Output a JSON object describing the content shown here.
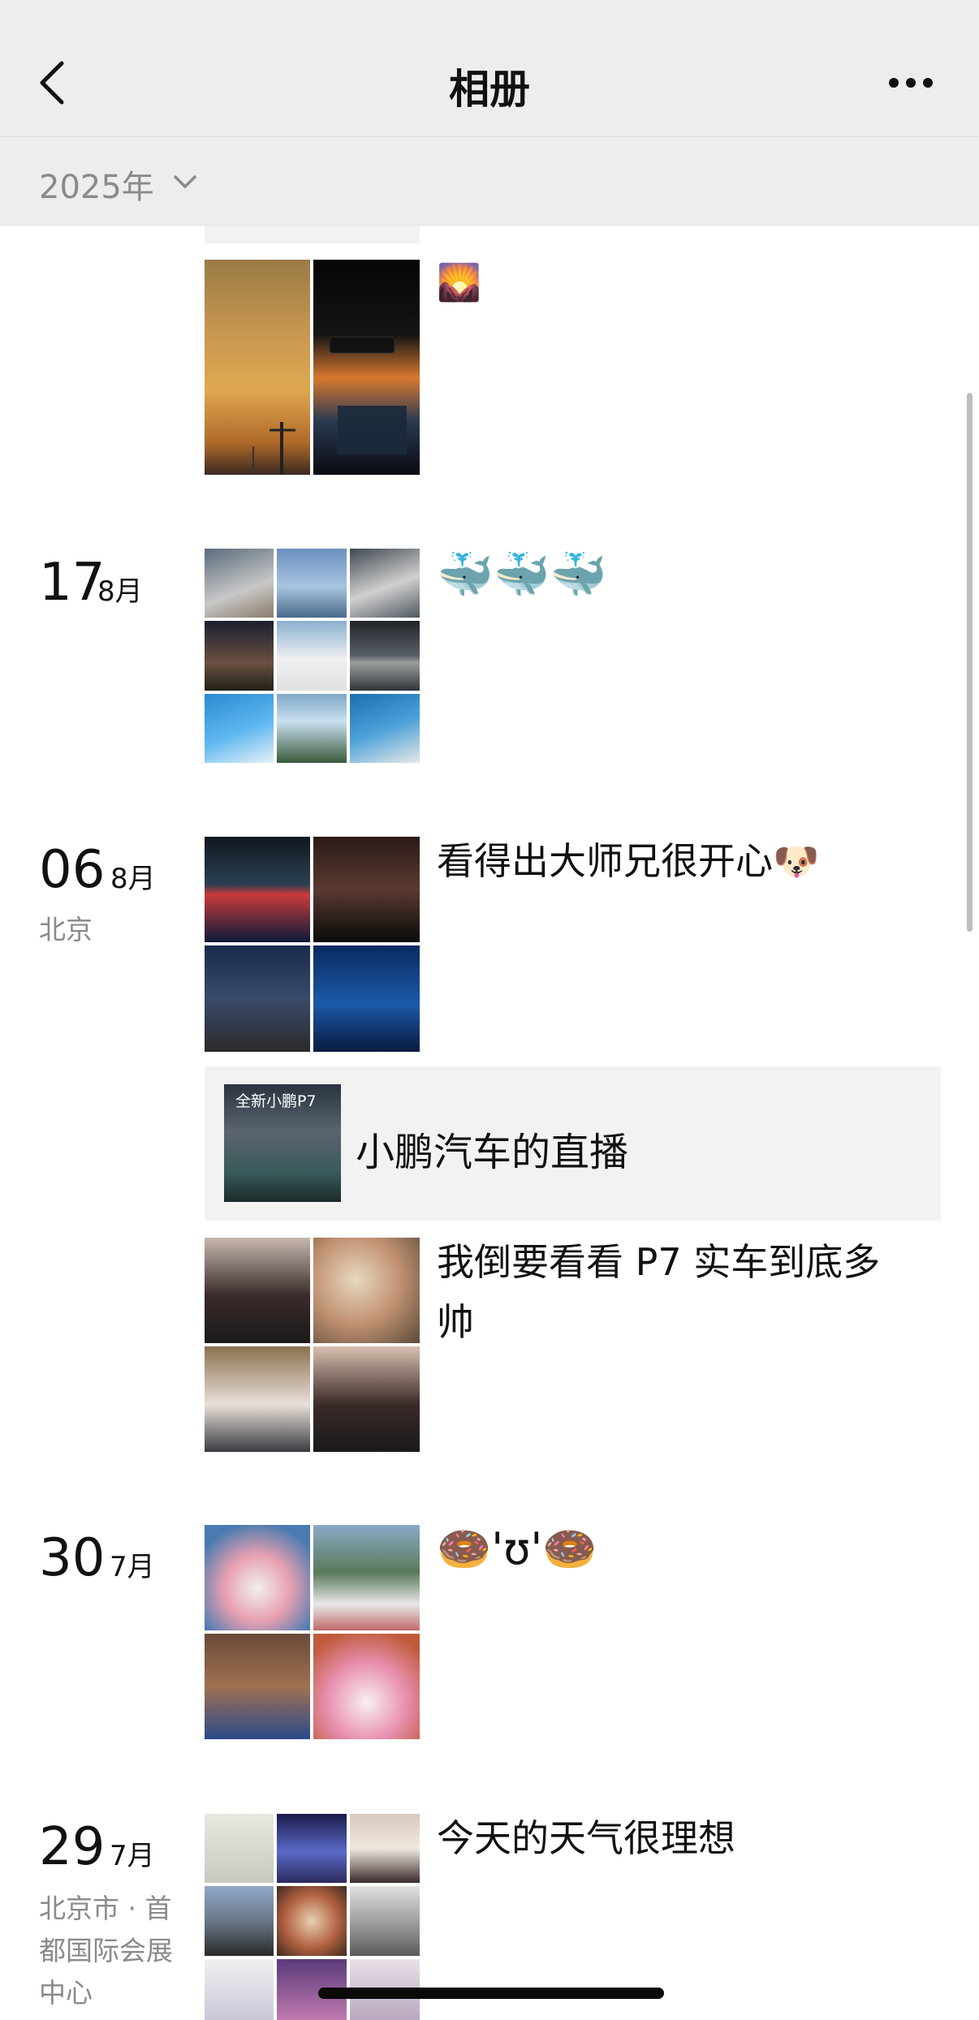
{
  "header": {
    "title": "相册",
    "back_icon": "chevron-left-icon",
    "more_icon": "more-dots-icon"
  },
  "year_selector": {
    "label": "2025年"
  },
  "entries": [
    {
      "day": "",
      "month": "",
      "location": "",
      "posts": [
        {
          "type": "photos",
          "text": "🌄"
        }
      ]
    },
    {
      "day": "17",
      "month": "8月",
      "location": "",
      "posts": [
        {
          "type": "photos",
          "text": "🐳🐳🐳"
        }
      ]
    },
    {
      "day": "06",
      "month": "8月",
      "location": "北京",
      "posts": [
        {
          "type": "photos",
          "text": "看得出大师兄很开心🐶"
        },
        {
          "type": "shared-link",
          "thumb_caption": "全新小鹏P7",
          "text": "小鹏汽车的直播"
        },
        {
          "type": "photos",
          "text_line1": "我倒要看看 P7 实车到底多",
          "text_line2": "帅"
        }
      ]
    },
    {
      "day": "30",
      "month": "7月",
      "location": "",
      "posts": [
        {
          "type": "photos",
          "text": "🍩'ʊ'🍩"
        }
      ]
    },
    {
      "day": "29",
      "month": "7月",
      "location_line1": "北京市 · 首",
      "location_line2": "都国际会展",
      "location_line3": "中心",
      "posts": [
        {
          "type": "photos",
          "text": "今天的天气很理想"
        }
      ]
    }
  ],
  "colors": {
    "header_bg": "#ededed",
    "share_bg": "#f2f2f2",
    "secondary_text": "#8a8a8a"
  }
}
